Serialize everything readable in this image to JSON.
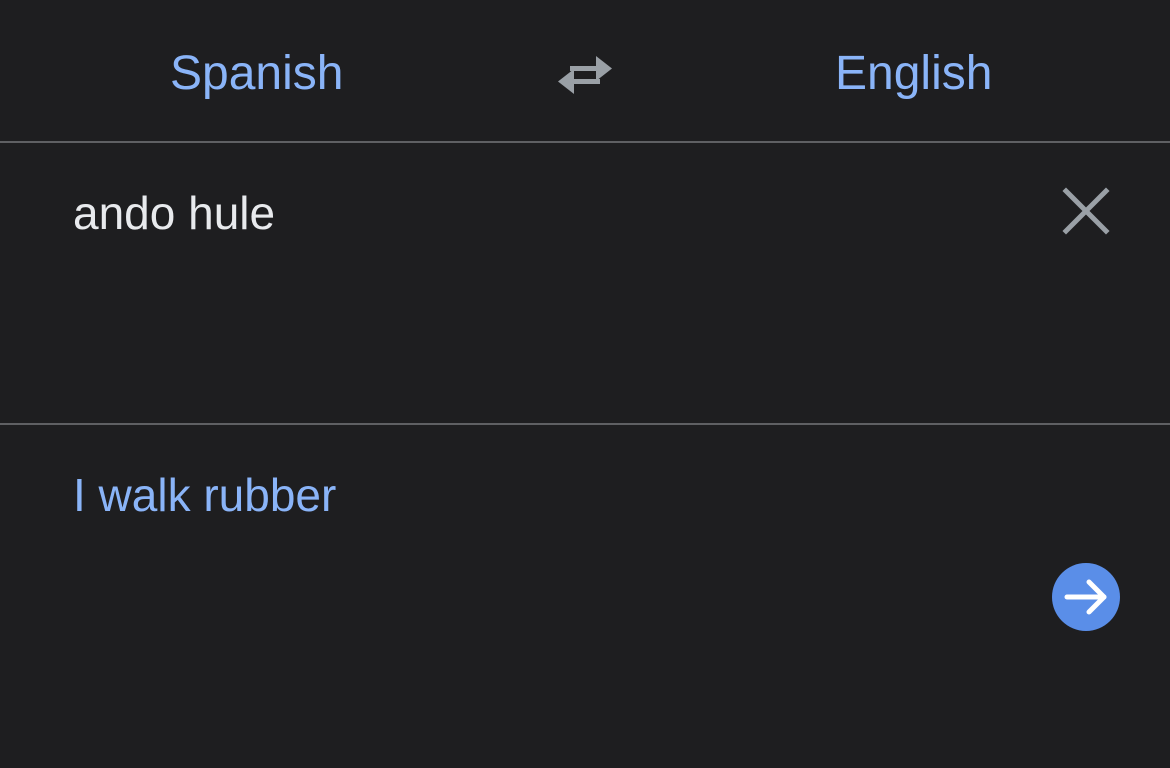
{
  "header": {
    "source_language": "Spanish",
    "target_language": "English",
    "swap_icon": "swap-arrows-icon"
  },
  "input": {
    "text": "ando hule",
    "clear_icon": "close-icon"
  },
  "output": {
    "text": "I walk rubber",
    "go_icon": "arrow-right-icon"
  },
  "colors": {
    "background": "#1e1e20",
    "accent": "#8ab4f8",
    "text": "#e8eaed",
    "divider": "#5f6063",
    "button": "#5a8ee8",
    "icon_gray": "#9aa0a6"
  }
}
